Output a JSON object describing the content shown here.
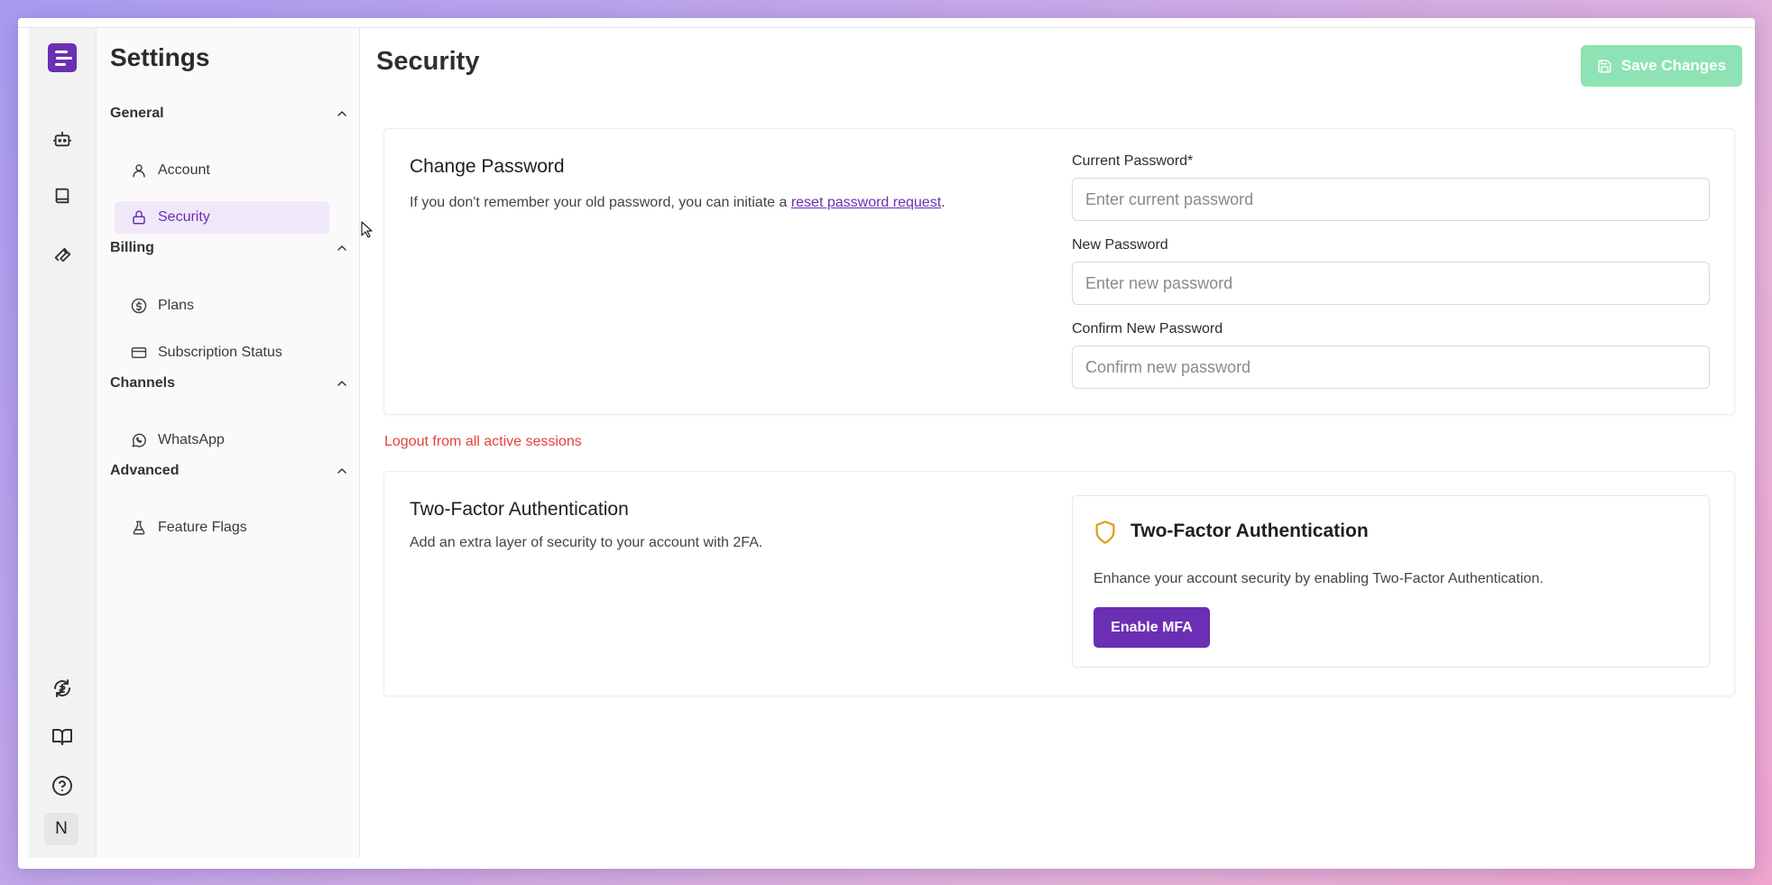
{
  "sidebar": {
    "title": "Settings",
    "groups": [
      {
        "label": "General",
        "items": [
          {
            "label": "Account",
            "icon": "user-icon"
          },
          {
            "label": "Security",
            "icon": "lock-icon",
            "active": true
          }
        ]
      },
      {
        "label": "Billing",
        "items": [
          {
            "label": "Plans",
            "icon": "dollar-circle-icon"
          },
          {
            "label": "Subscription Status",
            "icon": "credit-card-icon"
          }
        ]
      },
      {
        "label": "Channels",
        "items": [
          {
            "label": "WhatsApp",
            "icon": "whatsapp-icon"
          }
        ]
      },
      {
        "label": "Advanced",
        "items": [
          {
            "label": "Feature Flags",
            "icon": "flask-icon"
          }
        ]
      }
    ]
  },
  "rail": {
    "top_icons": [
      "logo-icon",
      "bot-icon",
      "book-icon",
      "wrench-icon"
    ],
    "bottom_icons": [
      "sync-icon",
      "docs-book-icon",
      "help-icon"
    ],
    "avatar_initial": "N"
  },
  "header": {
    "title": "Security",
    "save_label": "Save Changes"
  },
  "password_card": {
    "title": "Change Password",
    "desc_prefix": "If you don't remember your old password, you can initiate a ",
    "desc_link": "reset password request",
    "desc_suffix": ".",
    "fields": [
      {
        "label": "Current Password*",
        "placeholder": "Enter current password"
      },
      {
        "label": "New Password",
        "placeholder": "Enter new password"
      },
      {
        "label": "Confirm New Password",
        "placeholder": "Confirm new password"
      }
    ]
  },
  "logout_label": "Logout from all active sessions",
  "mfa_card": {
    "title": "Two-Factor Authentication",
    "desc": "Add an extra layer of security to your account with 2FA.",
    "box_title": "Two-Factor Authentication",
    "box_desc": "Enhance your account security by enabling Two-Factor Authentication.",
    "button_label": "Enable MFA"
  },
  "colors": {
    "accent": "#6b2fb3",
    "save_button": "#8de3b3",
    "danger": "#e5403c",
    "shield": "#e0a21c"
  }
}
